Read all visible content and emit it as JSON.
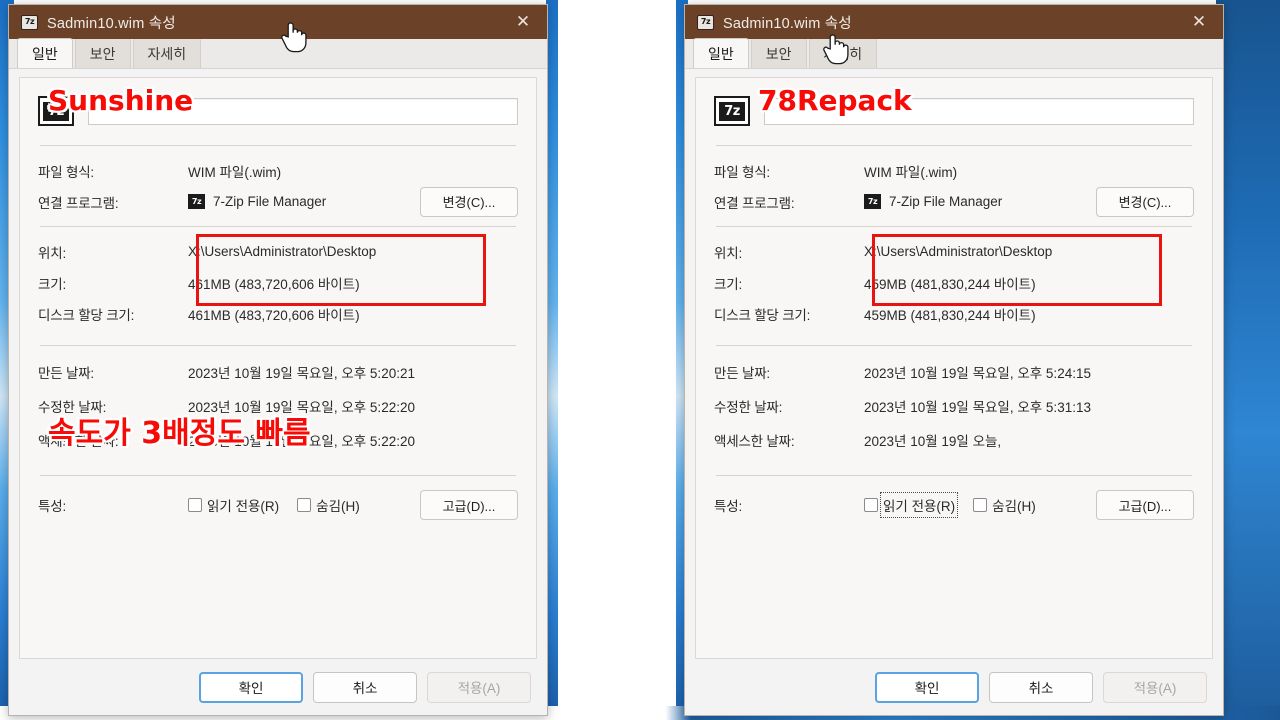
{
  "theme": {
    "titlebar_color": "#6b4227",
    "accent_blue": "#2f8fe0",
    "annotation_red": "#f60b06",
    "dialog_bg": "#f3f3f3"
  },
  "windows": [
    {
      "id": "left",
      "titlebar": {
        "icon": "file-properties-icon",
        "title": "Sadmin10.wim 속성",
        "close_label": "✕"
      },
      "tabs": [
        {
          "label": "일반",
          "active": true
        },
        {
          "label": "보안",
          "active": false
        },
        {
          "label": "자세히",
          "active": false
        }
      ],
      "file_header": {
        "icon_label": "7z",
        "name_value": "",
        "name_placeholder": ""
      },
      "fields": [
        {
          "label": "파일 형식:",
          "value": "WIM 파일(.wim)"
        },
        {
          "label": "연결 프로그램:",
          "value": "7-Zip File Manager",
          "icon": "7z",
          "button": "변경(C)...",
          "button_accel": "C"
        },
        {
          "label": "위치:",
          "value": "X:\\Users\\Administrator\\Desktop"
        },
        {
          "label": "크기:",
          "value": "461MB (483,720,606 바이트)"
        },
        {
          "label": "디스크 할당 크기:",
          "value": "461MB (483,720,606 바이트)"
        },
        {
          "label": "만든 날짜:",
          "value": "2023년 10월 19일 목요일, 오후 5:20:21"
        },
        {
          "label": "수정한 날짜:",
          "value": "2023년 10월 19일 목요일, 오후 5:22:20"
        },
        {
          "label": "액세스한 날짜:",
          "value": "2023년 10월 19일 목요일, 오후 5:22:20"
        }
      ],
      "attributes": {
        "label": "특성:",
        "readonly_label": "읽기 전용(R)",
        "readonly_checked": false,
        "hidden_label": "숨김(H)",
        "hidden_checked": false,
        "advanced_button": "고급(D)...",
        "focus_on_readonly": false,
        "underline_accelerators": false
      },
      "footer": {
        "ok": "확인",
        "cancel": "취소",
        "apply": "적용(A)",
        "apply_disabled": true
      },
      "annotations": {
        "name_overlay": "Sunshine",
        "note_overlay": "속도가 3배정도 빠름",
        "size_highlight": true
      }
    },
    {
      "id": "right",
      "titlebar": {
        "icon": "file-properties-icon",
        "title": "Sadmin10.wim 속성",
        "close_label": "✕"
      },
      "tabs": [
        {
          "label": "일반",
          "active": true
        },
        {
          "label": "보안",
          "active": false
        },
        {
          "label": "자세히",
          "active": false
        }
      ],
      "file_header": {
        "icon_label": "7z",
        "name_value": "",
        "name_placeholder": ""
      },
      "fields": [
        {
          "label": "파일 형식:",
          "value": "WIM 파일(.wim)"
        },
        {
          "label": "연결 프로그램:",
          "value": "7-Zip File Manager",
          "icon": "7z",
          "button": "변경(C)...",
          "button_accel": "C"
        },
        {
          "label": "위치:",
          "value": "X:\\Users\\Administrator\\Desktop"
        },
        {
          "label": "크기:",
          "value": "459MB (481,830,244 바이트)"
        },
        {
          "label": "디스크 할당 크기:",
          "value": "459MB (481,830,244 바이트)"
        },
        {
          "label": "만든 날짜:",
          "value": "2023년 10월 19일 목요일, 오후 5:24:15"
        },
        {
          "label": "수정한 날짜:",
          "value": "2023년 10월 19일 목요일, 오후 5:31:13"
        },
        {
          "label": "액세스한 날짜:",
          "value": "2023년 10월 19일 오늘,"
        }
      ],
      "attributes": {
        "label": "특성:",
        "readonly_label": "읽기 전용(R)",
        "readonly_checked": false,
        "hidden_label": "숨김(H)",
        "hidden_checked": false,
        "advanced_button": "고급(D)...",
        "focus_on_readonly": true,
        "underline_accelerators": true
      },
      "footer": {
        "ok": "확인",
        "cancel": "취소",
        "apply": "적용(A)",
        "apply_disabled": true
      },
      "annotations": {
        "name_overlay": "78Repack",
        "note_overlay": "",
        "size_highlight": true
      }
    }
  ]
}
